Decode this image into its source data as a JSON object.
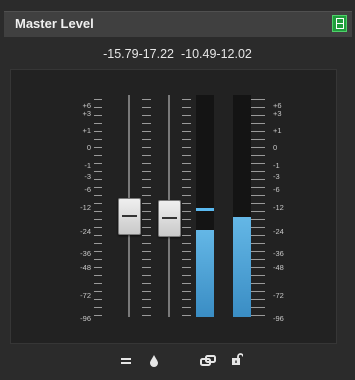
{
  "header": {
    "title": "Master Level"
  },
  "readouts": {
    "left_fader": "-15.79",
    "right_fader": "-17.22",
    "left_peak": "-10.49",
    "right_peak": "-12.02"
  },
  "scale": {
    "labels": [
      "+6",
      "+3",
      "+1",
      "0",
      "-1",
      "-3",
      "-6",
      "-12",
      "-24",
      "-36",
      "-48",
      "-72",
      "-96"
    ]
  },
  "meters": {
    "left_level_fraction": 0.39,
    "right_level_fraction": 0.45,
    "left_peak_fraction": 0.49
  },
  "colors": {
    "accent_green": "#1f9d3c",
    "meter_blue": "#3a8dc4"
  },
  "icons": {
    "link_faders": "equals-icon",
    "dither": "drop-icon",
    "link_meters": "link-icon",
    "lock": "unlock-icon"
  }
}
